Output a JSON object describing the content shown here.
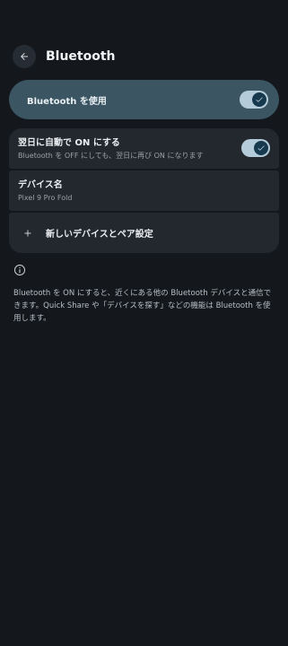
{
  "header": {
    "title": "Bluetooth",
    "back_icon": "arrow-left-icon"
  },
  "master_toggle": {
    "label": "Bluetooth を使用",
    "state": "on",
    "icon": "check-icon"
  },
  "settings": {
    "auto_on": {
      "title": "翌日に自動で ON にする",
      "subtitle": "Bluetooth を OFF にしても、翌日に再び ON になります",
      "state": "on"
    },
    "device_name": {
      "title": "デバイス名",
      "value": "Pixel 9 Pro Fold"
    },
    "pair_new": {
      "label": "新しいデバイスとペア設定",
      "icon": "plus-icon"
    }
  },
  "info": {
    "icon": "info-icon",
    "text": "Bluetooth を ON にすると、近くにある他の Bluetooth デバイスと通信できます。Quick Share や「デバイスを探す」などの機能は Bluetooth を使用します。"
  },
  "colors": {
    "background": "#14181c",
    "accent_card": "#3b5563",
    "toggle_track": "#b4cbd9",
    "toggle_thumb": "#17394d",
    "row_bg": "#22282e"
  }
}
